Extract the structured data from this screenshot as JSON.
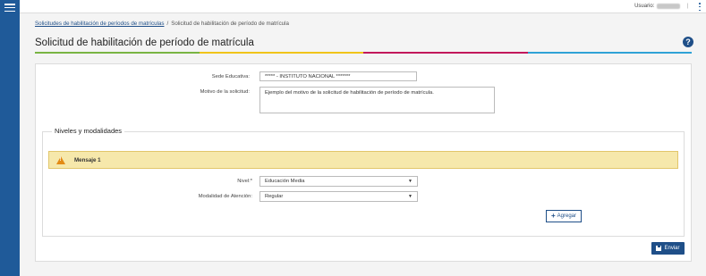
{
  "topbar": {
    "user_label": "Usuario:",
    "user_name": "",
    "separator": "|"
  },
  "breadcrumb": {
    "parent": "Solicitudes de habilitación de períodos de matrículas",
    "divider": "/",
    "current": "Solicitud de habilitación de período de matrícula"
  },
  "page": {
    "title": "Solicitud de habilitación de período de matrícula",
    "help_symbol": "?",
    "rule_colors": [
      "#79b443",
      "#f0c419",
      "#c2185b",
      "#2ea2d6"
    ]
  },
  "form": {
    "sede_label": "Sede Educativa:",
    "sede_value": "***** - INSTITUTO NACIONAL *******",
    "motivo_label": "Motivo de la solicitud:",
    "motivo_value": "Ejemplo del motivo de la solicitud de habilitación de período de matrícula."
  },
  "niveles": {
    "legend": "Niveles y modalidades",
    "warning_message": "Mensaje 1",
    "warning_icon": "warning-triangle-icon",
    "nivel_label": "Nivel:*",
    "nivel_value": "Educación Media",
    "modalidad_label": "Modalidad de Atención:",
    "modalidad_value": "Regular",
    "add_label": "Agregar"
  },
  "actions": {
    "send_label": "Enviar",
    "primary_color": "#1f4f88"
  }
}
